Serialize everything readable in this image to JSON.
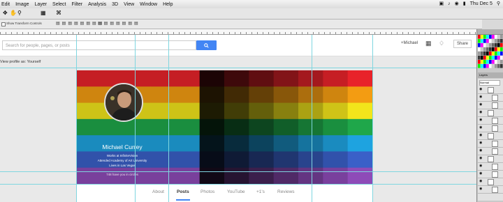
{
  "menubar": {
    "items": [
      "Edit",
      "Image",
      "Layer",
      "Select",
      "Filter",
      "Analysis",
      "3D",
      "View",
      "Window",
      "Help"
    ],
    "clock": "Thu Dec 5"
  },
  "options_bar": {
    "show_transform_controls": "Show Transform Controls"
  },
  "fb_header": {
    "search_placeholder": "Search for people, pages, or posts",
    "plus_user": "+Michael",
    "share": "Share"
  },
  "view_profile_as": "View profile as: Yourself",
  "profile": {
    "name": "Michael Currey",
    "works_at": "Works at InfiniteVision",
    "attended": "Attended Academy of Art University",
    "lives_in": "Lives in Las Vegas",
    "circles": "748 have you in circles"
  },
  "tabs": [
    {
      "label": "About",
      "active": false
    },
    {
      "label": "Posts",
      "active": true
    },
    {
      "label": "Photos",
      "active": false
    },
    {
      "label": "YouTube",
      "active": false
    },
    {
      "label": "+1's",
      "active": false
    },
    {
      "label": "Reviews",
      "active": false
    }
  ],
  "colors": {
    "search_button": "#4285f4",
    "guides": "#7fd6e0",
    "stripe_hues": [
      "#e8232a",
      "#f39c12",
      "#f2e51b",
      "#1fa74a",
      "#1ea3e0",
      "#3a60c8",
      "#8e4bb8"
    ]
  },
  "layers_panel": {
    "tab_label": "Layers",
    "blend_mode": "Normal"
  }
}
